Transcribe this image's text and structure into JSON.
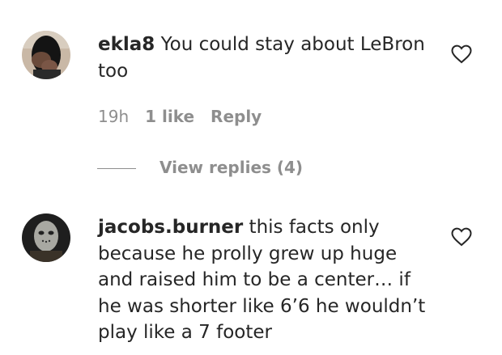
{
  "comments": [
    {
      "username": "ekla8",
      "text": " You could stay about LeBron too",
      "time": "19h",
      "likes": "1 like",
      "reply_label": "Reply",
      "view_replies": "View replies (4)"
    },
    {
      "username": "jacobs.burner",
      "text": " this facts only because he prolly grew up huge and raised him to be a center… if he was shorter like 6’6 he wouldn’t play like a 7 footer"
    }
  ]
}
